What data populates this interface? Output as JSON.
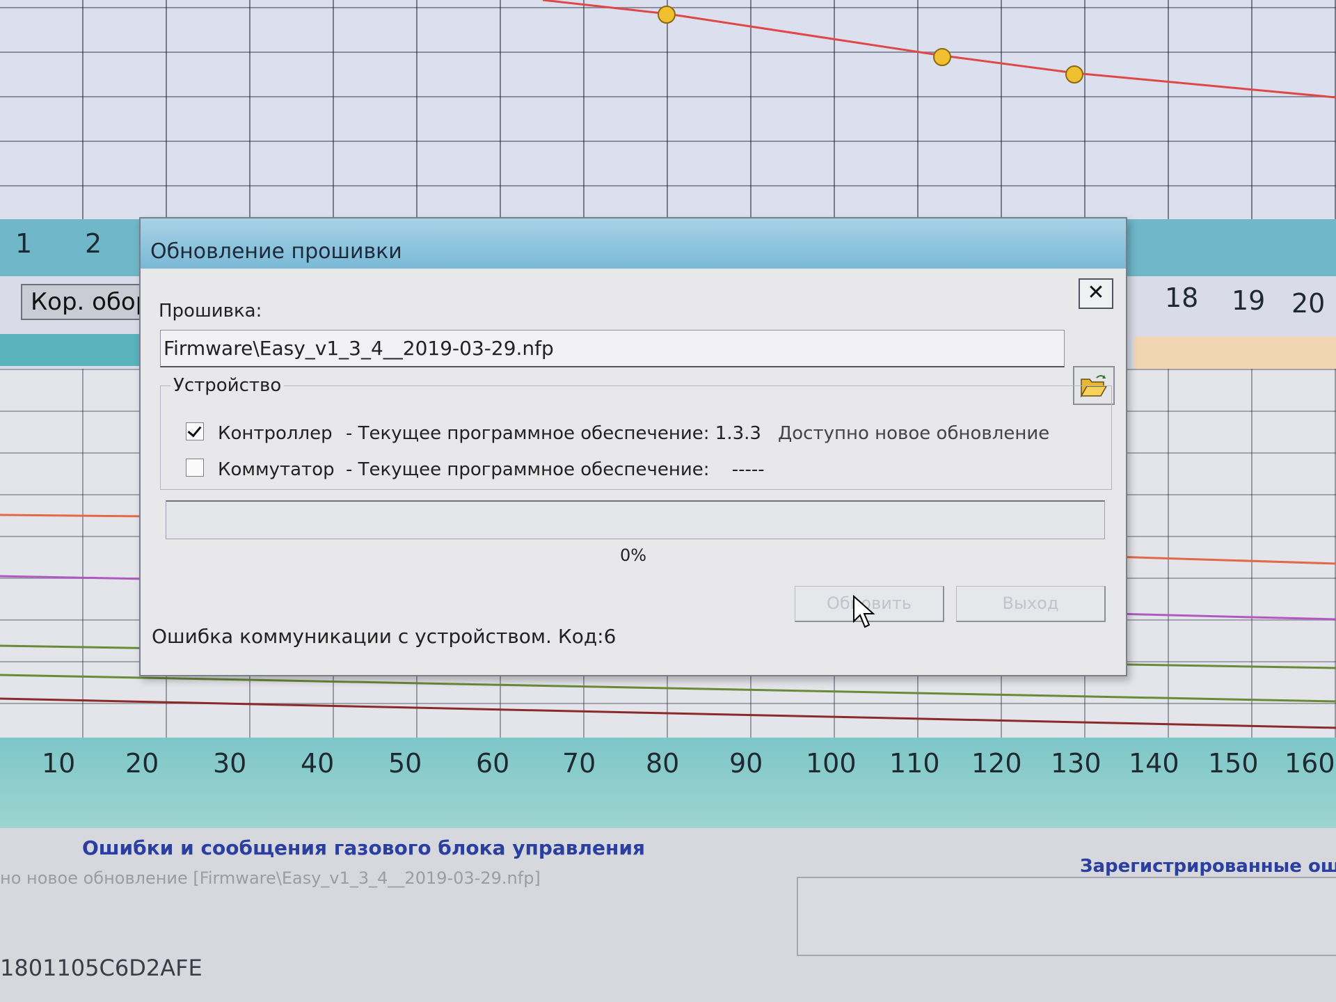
{
  "background_app": {
    "upper_axis_ticks": [
      "1",
      "2",
      "18",
      "19",
      "20"
    ],
    "tab_label": "Кор. обор",
    "x_axis_ticks": [
      "10",
      "20",
      "30",
      "40",
      "50",
      "60",
      "70",
      "80",
      "90",
      "100",
      "110",
      "120",
      "130",
      "140",
      "150",
      "160"
    ],
    "errors_panel_title": "Ошибки и сообщения газового блока управления",
    "errors_panel_line": "но новое обновление [Firmware\\Easy_v1_3_4__2019-03-29.nfp]",
    "registered_errors_title": "Зарегистрированные ошиб",
    "device_id": "1801105C6D2AFE"
  },
  "dialog": {
    "title": "Обновление прошивки",
    "close_label": "✕",
    "firmware_label": "Прошивка:",
    "firmware_path": "Firmware\\Easy_v1_3_4__2019-03-29.nfp",
    "device_group_label": "Устройство",
    "devices": [
      {
        "name": "Контроллер",
        "checked": true,
        "software_label": "- Текущее программное обеспечение:",
        "version": "1.3.3",
        "update_status": "Доступно новое обновление"
      },
      {
        "name": "Коммутатор",
        "checked": false,
        "software_label": "- Текущее программное обеспечение:",
        "version": "-----",
        "update_status": ""
      }
    ],
    "progress": {
      "value_percent": 0,
      "label": "0%"
    },
    "update_button_label": "Обновить",
    "exit_button_label": "Выход",
    "status_message": "Ошибка коммуникации с устройством. Код:6"
  },
  "colors": {
    "titlebar": "#79b9d6",
    "upper_band": "#6fb7c9",
    "x_axis_band": "#8fcdcc",
    "curve_red": "#e04848",
    "marker_yellow": "#f0c030",
    "panel_title_blue": "#2a3fa0"
  },
  "icons": [
    "close-icon",
    "folder-open-icon",
    "checkbox-checked-icon",
    "checkbox-empty-icon",
    "mouse-pointer-icon"
  ]
}
